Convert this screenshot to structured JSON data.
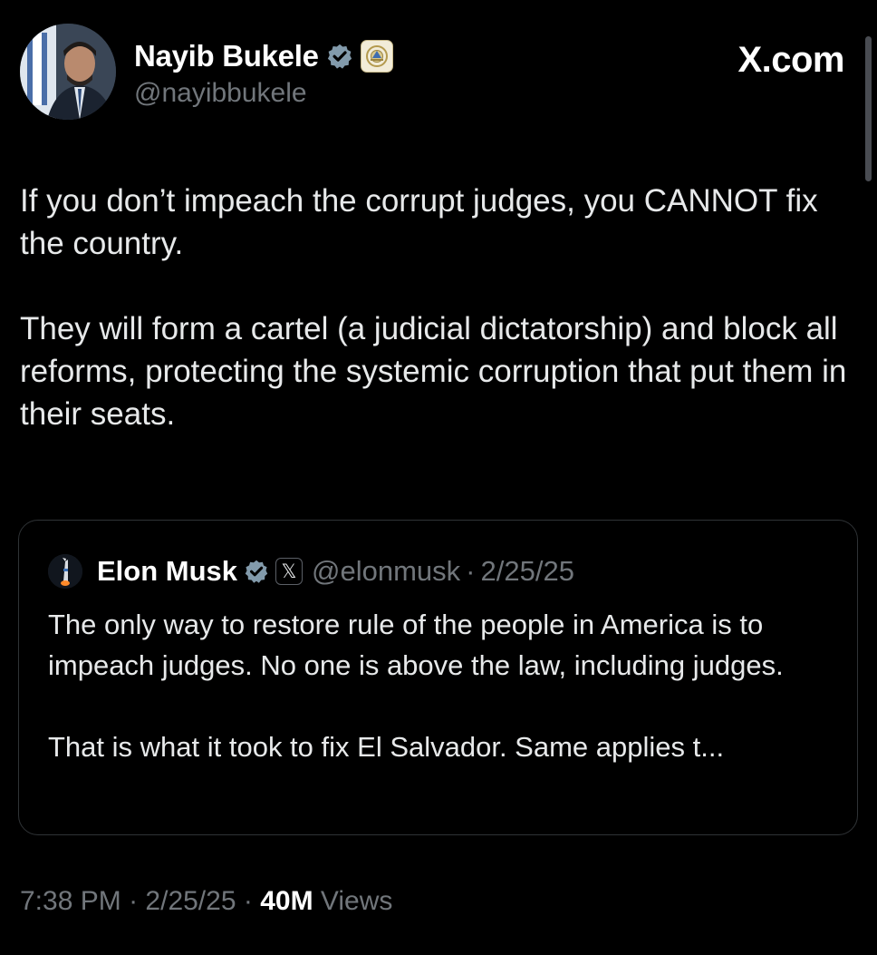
{
  "author": {
    "name": "Nayib Bukele",
    "handle": "@nayibbukele",
    "avatar_icon": "avatar-photo",
    "verified_badge_icon": "verified-badge-icon",
    "affiliation_badge_icon": "government-seal-icon"
  },
  "site": {
    "logo_text": "X.com"
  },
  "tweet": {
    "paragraphs": [
      "If you don’t impeach the corrupt judges, you CANNOT fix the country.",
      "They will form a cartel (a judicial dictatorship) and block all reforms, protecting the systemic corruption that put them in their seats."
    ]
  },
  "quote": {
    "name": "Elon Musk",
    "handle": "@elonmusk",
    "separator": "·",
    "date": "2/25/25",
    "affiliation_icon_text": "𝕏",
    "paragraphs": [
      "The only way to restore rule of the people in America is to impeach judges. No one is above the law, including judges.",
      "That is what it took to fix El Salvador. Same applies t..."
    ]
  },
  "meta": {
    "time": "7:38 PM",
    "separator": "·",
    "date": "2/25/25",
    "views_count": "40M",
    "views_label": "Views"
  },
  "colors": {
    "background": "#000000",
    "text_primary": "#e7e9ea",
    "text_secondary": "#71767b",
    "verified_blue_gray": "#829aab",
    "border": "#2f3336"
  }
}
